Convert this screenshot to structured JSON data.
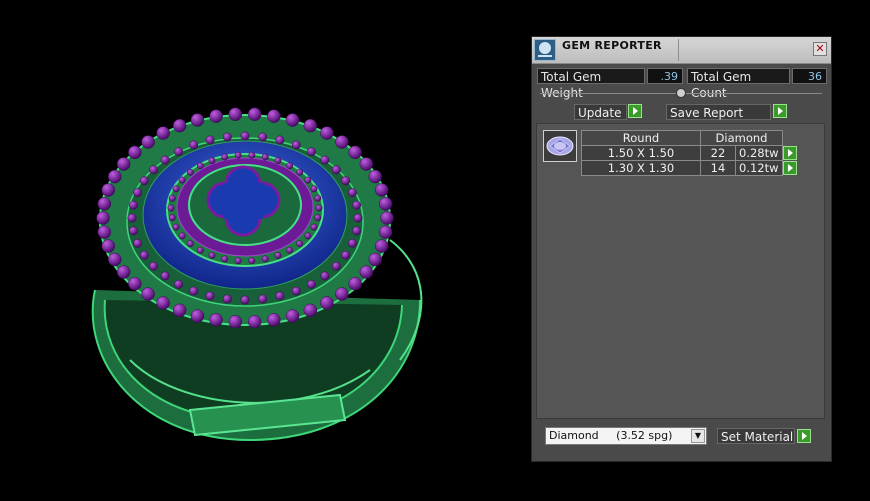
{
  "panel": {
    "title": "GEM REPORTER",
    "icon": "gem-reporter-icon",
    "close_label": "✕"
  },
  "stats": {
    "total_weight_label": "Total Gem Weight",
    "total_weight_value": ".39",
    "total_count_label": "Total Gem Count",
    "total_count_value": "36"
  },
  "actions": {
    "update_label": "Update",
    "save_report_label": "Save Report"
  },
  "report": {
    "headers": [
      "Round",
      "Diamond"
    ],
    "rows": [
      {
        "size": "1.50 X 1.50",
        "count": "22",
        "weight": "0.28tw"
      },
      {
        "size": "1.30 X 1.30",
        "count": "14",
        "weight": "0.12tw"
      }
    ]
  },
  "material": {
    "selected": "Diamond     (3.52 spg)",
    "set_label": "Set Material"
  },
  "colors": {
    "metal": "#2f9f60",
    "beads": "#7a1aa0",
    "stones": "#1e3fae",
    "go_button": "#3a9a2a"
  }
}
